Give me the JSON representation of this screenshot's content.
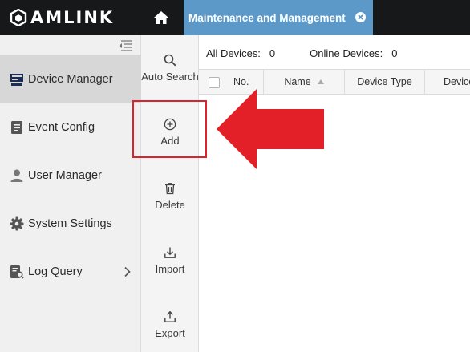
{
  "app": {
    "brand": "AMLINK",
    "tab_label": "Maintenance and Management"
  },
  "icons": {
    "logo": "amlink-logo-icon",
    "home": "home-icon",
    "tab_close": "close-circle-icon",
    "collapse": "collapse-menu-icon"
  },
  "colors": {
    "topbar": "#17181a",
    "tab": "#5c98c8",
    "sidebar_active": "#d7d7d7",
    "annotation": "#e0202a"
  },
  "sidebar": {
    "items": [
      {
        "label": "Device Manager",
        "icon": "device-manager-icon",
        "active": true
      },
      {
        "label": "Event Config",
        "icon": "event-config-icon"
      },
      {
        "label": "User Manager",
        "icon": "user-icon"
      },
      {
        "label": "System Settings",
        "icon": "gear-icon"
      },
      {
        "label": "Log Query",
        "icon": "log-query-icon",
        "has_submenu": true
      }
    ]
  },
  "toolbar": {
    "items": [
      {
        "label": "Auto Search",
        "icon": "search-icon"
      },
      {
        "label": "Add",
        "icon": "add-circle-icon",
        "highlighted": true
      },
      {
        "label": "Delete",
        "icon": "trash-icon"
      },
      {
        "label": "Import",
        "icon": "import-icon"
      },
      {
        "label": "Export",
        "icon": "export-icon"
      }
    ]
  },
  "main": {
    "all_devices_label": "All Devices:",
    "all_devices_count": "0",
    "online_devices_label": "Online Devices:",
    "online_devices_count": "0",
    "columns": [
      "No.",
      "Name",
      "Device Type",
      "Device"
    ]
  },
  "annotation": {
    "target": "Add",
    "shapes": [
      "highlight-box",
      "left-arrow"
    ]
  }
}
